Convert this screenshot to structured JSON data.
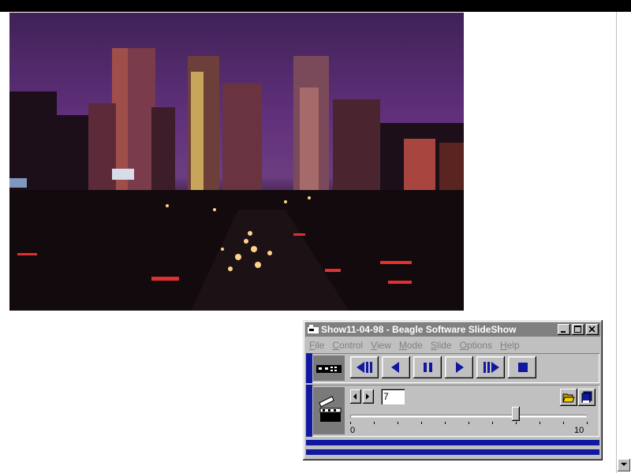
{
  "window": {
    "title": "Show11-04-98 - Beagle Software SlideShow",
    "caption_buttons": [
      "minimize-icon",
      "maximize-icon",
      "close-icon"
    ]
  },
  "menu": {
    "items": [
      {
        "label": "File",
        "accel": "F"
      },
      {
        "label": "Control",
        "accel": "C"
      },
      {
        "label": "View",
        "accel": "V"
      },
      {
        "label": "Mode",
        "accel": "M"
      },
      {
        "label": "Slide",
        "accel": "S"
      },
      {
        "label": "Options",
        "accel": "O"
      },
      {
        "label": "Help",
        "accel": "H"
      }
    ]
  },
  "transport": {
    "buttons": [
      "skip-back-icon",
      "play-reverse-icon",
      "pause-icon",
      "play-icon",
      "skip-forward-icon",
      "stop-icon"
    ],
    "color": "#1018a0"
  },
  "slide_control": {
    "current_slide": "7",
    "slider_min_label": "0",
    "slider_max_label": "10",
    "slider_value": 7
  },
  "photo": {
    "subject": "city skyline at dusk with highway traffic"
  },
  "colors": {
    "accent": "#1018a0",
    "face": "#c0c0c0",
    "title_inactive": "#808080"
  }
}
